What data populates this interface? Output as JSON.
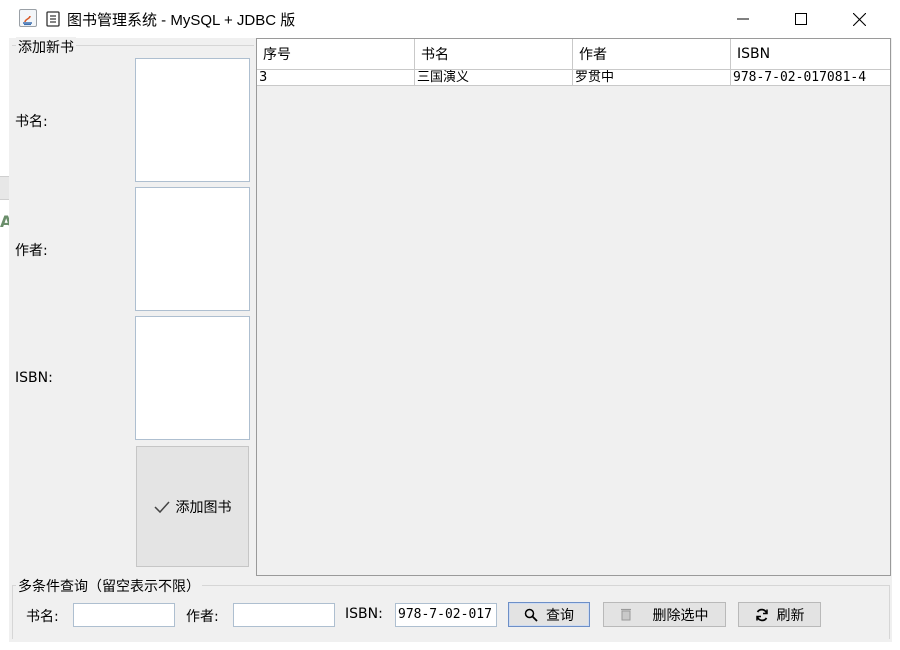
{
  "window": {
    "title": "图书管理系统 - MySQL + JDBC 版",
    "controls": [
      "minimize",
      "maximize",
      "close"
    ]
  },
  "add_panel": {
    "title": "添加新书",
    "fields": [
      {
        "label": "书名:"
      },
      {
        "label": "作者:"
      },
      {
        "label": "ISBN:"
      }
    ],
    "add_button": "添加图书"
  },
  "table": {
    "columns": [
      "序号",
      "书名",
      "作者",
      "ISBN"
    ],
    "rows": [
      [
        "3",
        "三国演义",
        "罗贯中",
        "978-7-02-017081-4"
      ]
    ]
  },
  "query_panel": {
    "title": "多条件查询（留空表示不限）",
    "title_label": "书名:",
    "title_value": "",
    "author_label": "作者:",
    "author_value": "",
    "isbn_label": "ISBN:",
    "isbn_value": "978-7-02-017",
    "query_button": "查询",
    "delete_button": "删除选中",
    "refresh_button": "刷新"
  },
  "icons": {
    "app": "java-app-icon",
    "window": "book-db-icon",
    "add": "check-icon",
    "query": "search-icon",
    "delete": "trash-icon",
    "refresh": "refresh-icon"
  }
}
